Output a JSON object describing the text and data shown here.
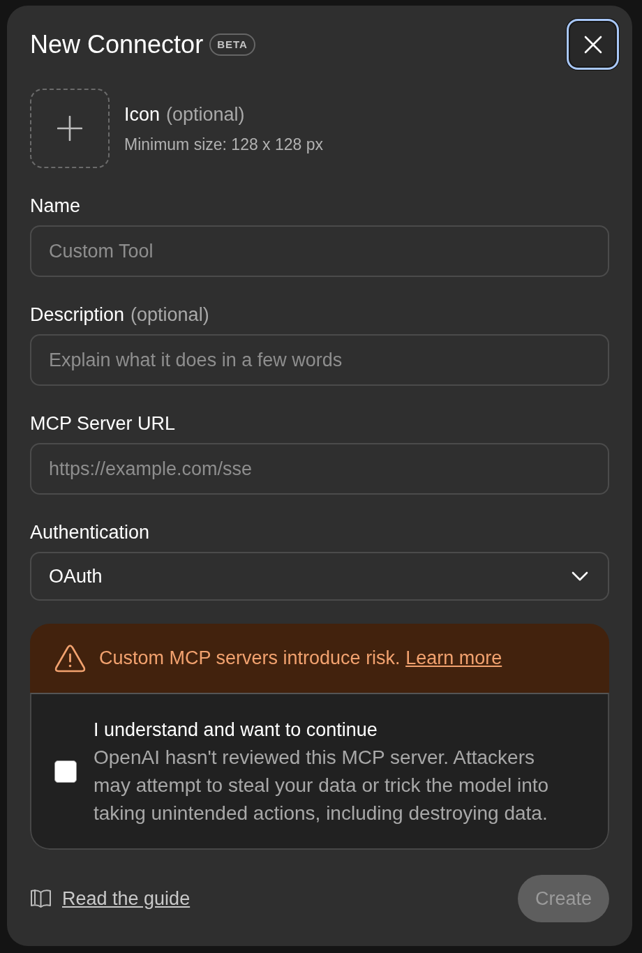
{
  "dialog": {
    "title": "New Connector",
    "badge": "BETA",
    "close_button": {
      "focused": true
    }
  },
  "icon_upload": {
    "label": "Icon",
    "optional": "(optional)",
    "hint": "Minimum size: 128 x 128 px"
  },
  "fields": [
    {
      "kind": "text",
      "label": "Name",
      "placeholder": "Custom Tool"
    },
    {
      "kind": "text",
      "label": "Description",
      "optional": "(optional)",
      "placeholder": "Explain what it does in a few words"
    },
    {
      "kind": "text",
      "label": "MCP Server URL",
      "placeholder": "https://example.com/sse"
    },
    {
      "kind": "select",
      "label": "Authentication",
      "value": "OAuth"
    }
  ],
  "warning": {
    "message": "Custom MCP servers introduce risk.",
    "link": "Learn more",
    "consent": {
      "checked": false,
      "title": "I understand and want to continue",
      "body": "OpenAI hasn't reviewed this MCP server. Attackers may attempt to steal your data or trick the model into taking unintended actions, including destroying data."
    }
  },
  "footer": {
    "guide_link": "Read the guide",
    "create_button": {
      "label": "Create",
      "disabled": true
    }
  }
}
